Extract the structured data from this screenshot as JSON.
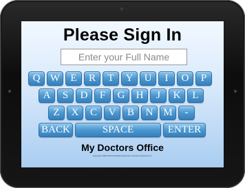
{
  "screen": {
    "title": "Please Sign In",
    "name_placeholder": "Enter your Full Name",
    "name_value": ""
  },
  "keyboard": {
    "rows": [
      [
        "Q",
        "W",
        "E",
        "R",
        "T",
        "Y",
        "U",
        "I",
        "O",
        "P"
      ],
      [
        "A",
        "S",
        "D",
        "F",
        "G",
        "H",
        "J",
        "K",
        "L"
      ],
      [
        "Z",
        "X",
        "C",
        "V",
        "B",
        "N",
        "M",
        "-"
      ]
    ],
    "back_label": "BACK",
    "space_label": "SPACE",
    "enter_label": "ENTER",
    "key_color": "#4b97cf"
  },
  "footer": {
    "office_name": "My Doctors Office",
    "copyright": "Copyright 2009-2013 All Rights Reserved. Check-In Systems Inc."
  }
}
